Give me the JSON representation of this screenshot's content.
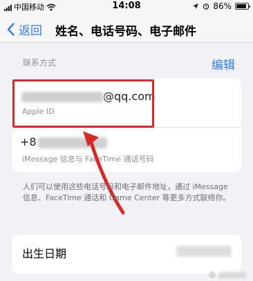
{
  "status_bar": {
    "carrier": "中国移动",
    "time": "14:08",
    "battery": "86%",
    "battery_level": 0.86
  },
  "nav": {
    "back_label": "返回",
    "title": "姓名、电话号码、电子邮件"
  },
  "contact_section": {
    "header": "联系方式",
    "edit_label": "编辑",
    "email": {
      "value_visible": "@qq.com",
      "sublabel": "Apple ID"
    },
    "phone": {
      "value_prefix": "+8",
      "sublabel": "iMessage 信息与 FaceTime 通话号码"
    }
  },
  "footnote": "人们可以使用这些电话号码和电子邮件地址，通过 iMessage 信息、FaceTime 通话和 Game Center 等更多方式联络你。",
  "birth": {
    "label": "出生日期"
  },
  "colors": {
    "accent": "#2f7bf5",
    "highlight": "#d42a2a"
  },
  "icons": [
    "signal-icon",
    "wifi-icon",
    "chevron-left-icon",
    "location-icon",
    "alarm-icon",
    "battery-icon"
  ]
}
